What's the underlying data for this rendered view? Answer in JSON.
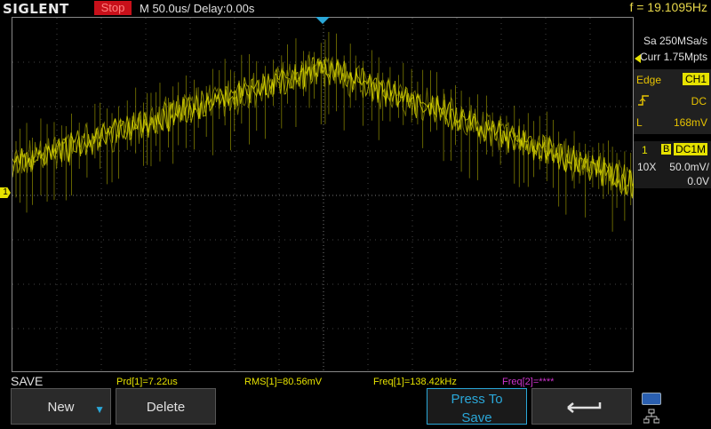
{
  "header": {
    "brand": "SIGLENT",
    "run_status": "Stop",
    "timebase": "M 50.0us/  Delay:0.00s",
    "frequency_counter": "f = 19.1095Hz"
  },
  "acquisition": {
    "sample_rate": "Sa 250MSa/s",
    "memory_depth": "Curr 1.75Mpts"
  },
  "trigger": {
    "mode": "Edge",
    "source": "CH1",
    "slope_icon": "rising-edge-icon",
    "coupling": "DC",
    "level_label": "L",
    "level": "168mV"
  },
  "channel1": {
    "number": "1",
    "bw_limit": "B",
    "coupling": "DC1M",
    "probe": "10X",
    "scale": "50.0mV/",
    "offset": "0.0V",
    "marker": "1",
    "color": "#e6e200"
  },
  "menu": {
    "title": "SAVE"
  },
  "measurements": [
    "Prd[1]=7.22us",
    "RMS[1]=80.56mV",
    "Freq[1]=138.42kHz",
    "Freq[2]=****"
  ],
  "softkeys": {
    "new_label": "New",
    "delete_label": "Delete",
    "save_label_line1": "Press To",
    "save_label_line2": "Save"
  },
  "colors": {
    "trace": "#e6e200",
    "accent": "#2aa7d8",
    "stop": "#c8101a"
  }
}
